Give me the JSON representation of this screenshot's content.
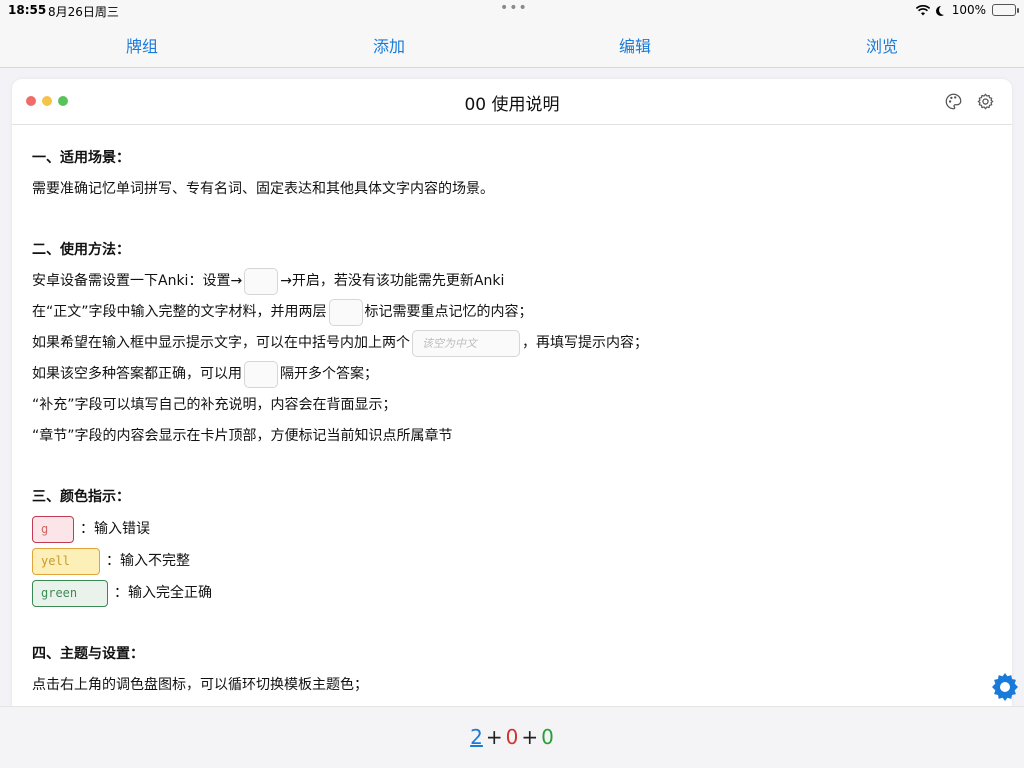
{
  "status_bar": {
    "time": "18:55",
    "date": "8月26日周三",
    "multitask_dots": "•••",
    "battery": "100%"
  },
  "nav": {
    "tabs": [
      "牌组",
      "添加",
      "编辑",
      "浏览"
    ]
  },
  "card": {
    "title": "00 使用说明",
    "traffic_colors": [
      "#f26b6b",
      "#f5c24a",
      "#5ac25a"
    ]
  },
  "content": {
    "s1_title": "一、适用场景：",
    "s1_text": "需要准确记忆单词拼写、专有名词、固定表达和其他具体文字内容的场景。",
    "s2_title": "二、使用方法：",
    "s2_l1a": "安卓设备需设置一下Anki：设置→",
    "s2_l1b": "→开启，若没有该功能需先更新Anki",
    "s2_l2a": "在“正文”字段中输入完整的文字材料，并用两层",
    "s2_l2b": "标记需要重点记忆的内容；",
    "s2_l3a": "如果希望在输入框中显示提示文字，可以在中括号内加上两个",
    "s2_hint": "该空为中文",
    "s2_l3b": "，再填写提示内容；",
    "s2_l4a": "如果该空多种答案都正确，可以用",
    "s2_l4b": "隔开多个答案；",
    "s2_l5": "“补充”字段可以填写自己的补充说明，内容会在背面显示；",
    "s2_l6": "“章节”字段的内容会显示在卡片顶部，方便标记当前知识点所属章节",
    "s3_title": "三、颜色指示：",
    "swatch_red": "g",
    "swatch_red_label": "：输入错误",
    "swatch_yellow": "yell",
    "swatch_yellow_label": "：输入不完整",
    "swatch_green": "green",
    "swatch_green_label": "：输入完全正确",
    "s4_title": "四、主题与设置：",
    "s4_text": "点击右上角的调色盘图标，可以循环切换模板主题色；"
  },
  "counts": {
    "new": "2",
    "learn": "0",
    "review": "0",
    "separator": "+"
  },
  "colors": {
    "accent": "#1a7ad9",
    "float_gear": "#1a7ad9"
  }
}
